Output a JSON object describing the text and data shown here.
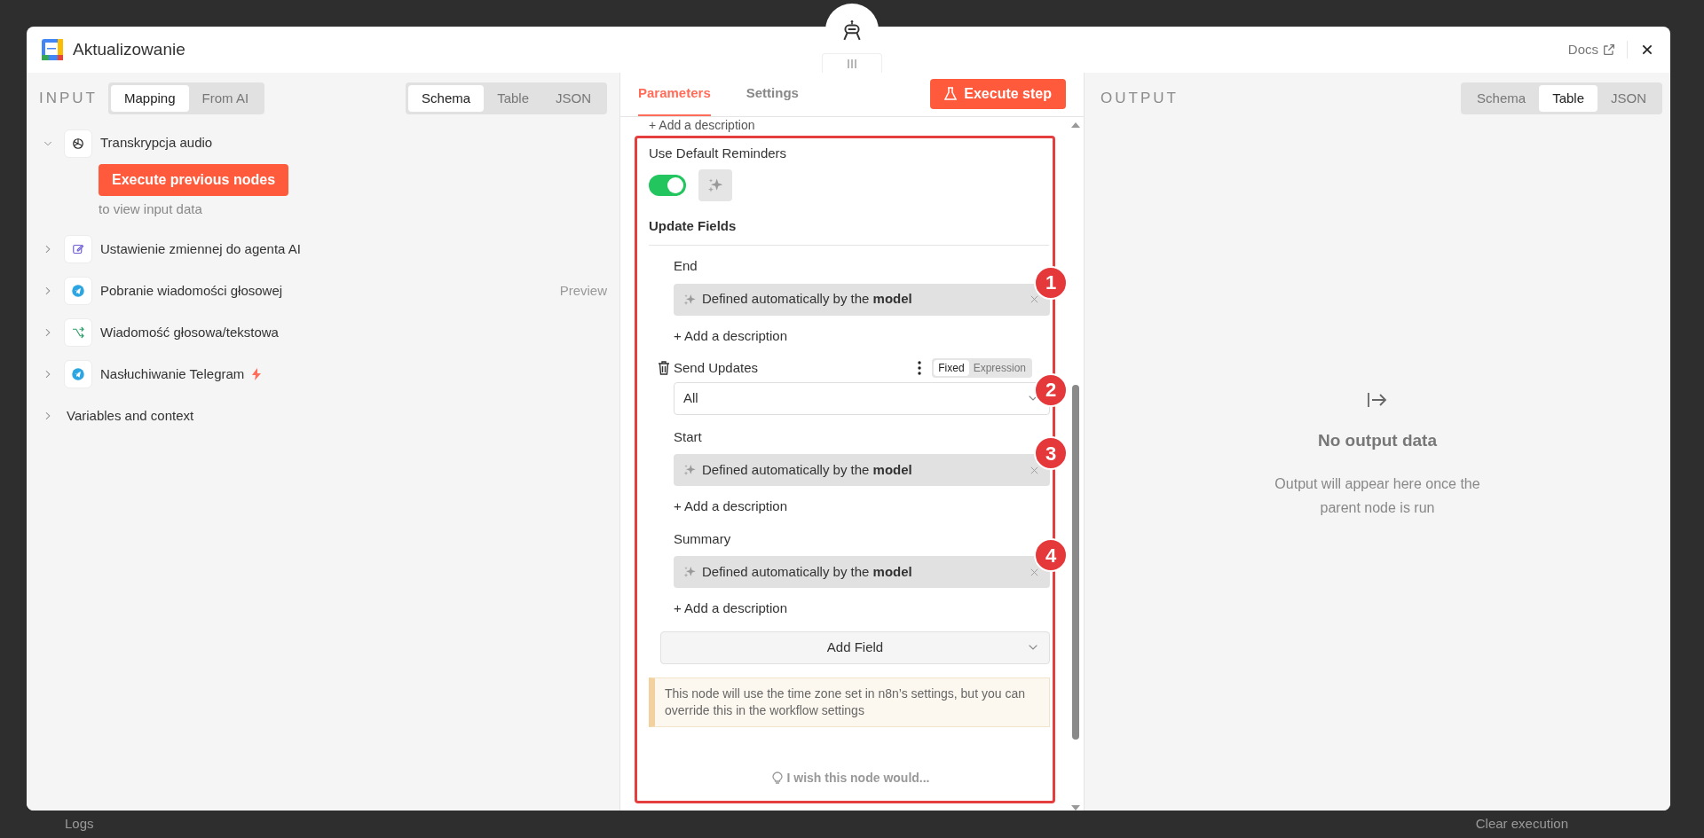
{
  "window": {
    "title": "Aktualizowanie",
    "docs_label": "Docs"
  },
  "background": {
    "logs_label": "Logs",
    "clear_label": "Clear execution"
  },
  "input_panel": {
    "label": "INPUT",
    "mode_tabs": [
      {
        "label": "Mapping",
        "selected": true
      },
      {
        "label": "From AI",
        "selected": false
      }
    ],
    "view_tabs": [
      {
        "label": "Schema",
        "selected": true
      },
      {
        "label": "Table",
        "selected": false
      },
      {
        "label": "JSON",
        "selected": false
      }
    ],
    "nodes": [
      {
        "kind": "openai",
        "name": "Transkrypcja audio",
        "expanded": true,
        "trigger": false
      },
      {
        "kind": "edit",
        "name": "Ustawienie zmiennej do agenta AI",
        "expanded": false,
        "trigger": false
      },
      {
        "kind": "telegram",
        "name": "Pobranie wiadomości głosowej",
        "expanded": false,
        "trigger": false,
        "preview": "Preview"
      },
      {
        "kind": "switch",
        "name": "Wiadomość głosowa/tekstowa",
        "expanded": false,
        "trigger": false
      },
      {
        "kind": "telegram",
        "name": "Nasłuchiwanie Telegram",
        "expanded": false,
        "trigger": true
      }
    ],
    "execute_button": "Execute previous nodes",
    "hint": "to view input data",
    "variables_label": "Variables and context"
  },
  "parameters_panel": {
    "tabs": [
      {
        "label": "Parameters",
        "selected": true
      },
      {
        "label": "Settings",
        "selected": false
      }
    ],
    "execute_button": "Execute step",
    "partial_description": "+ Add a description",
    "reminders": {
      "label": "Use Default Reminders",
      "on": true
    },
    "section_title": "Update Fields",
    "fields": [
      {
        "kind": "model",
        "label": "End",
        "value": "Defined automatically by the **model**",
        "add_description": "+ Add a description",
        "marker": "1"
      },
      {
        "kind": "select",
        "label": "Send Updates",
        "value": "All",
        "marker": "2",
        "mode_tabs": [
          {
            "label": "Fixed",
            "selected": true
          },
          {
            "label": "Expression",
            "selected": false
          }
        ]
      },
      {
        "kind": "model",
        "label": "Start",
        "value": "Defined automatically by the **model**",
        "add_description": "+ Add a description",
        "marker": "3"
      },
      {
        "kind": "model",
        "label": "Summary",
        "value": "Defined automatically by the **model**",
        "add_description": "+ Add a description",
        "marker": "4"
      }
    ],
    "add_field_button": "Add Field",
    "notice": "This node will use the time zone set in n8n’s settings, but you can override this in the workflow settings",
    "feedback": "I wish this node would..."
  },
  "output_panel": {
    "label": "OUTPUT",
    "view_tabs": [
      {
        "label": "Schema",
        "selected": false
      },
      {
        "label": "Table",
        "selected": true
      },
      {
        "label": "JSON",
        "selected": false
      }
    ],
    "empty_title": "No output data",
    "empty_text": "Output will appear here once the parent node is run"
  }
}
